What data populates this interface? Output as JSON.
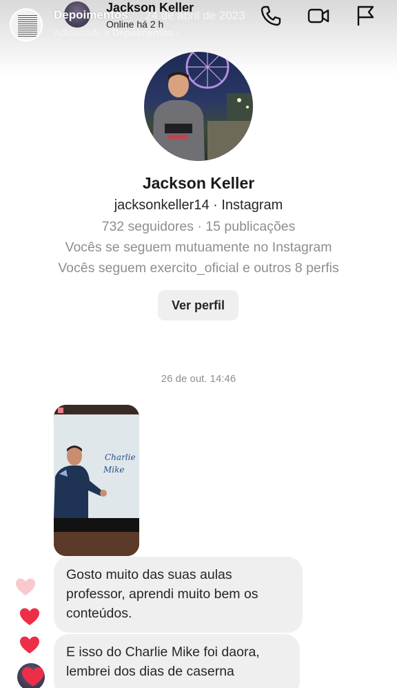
{
  "story": {
    "title": "Depoimentos",
    "date": "24 de abril de 2023",
    "added_prefix": "Adicionado a ",
    "added_target": "Depoimentos",
    "chevron": "chevron-right-icon"
  },
  "chat": {
    "name": "Jackson Keller",
    "status": "Online há 2 h",
    "icons": [
      "phone-icon",
      "video-camera-icon",
      "flag-icon"
    ]
  },
  "profile": {
    "name": "Jackson Keller",
    "handle": "jacksonkeller14 · Instagram",
    "stats": "732 seguidores · 15 publicações",
    "mutual": "Vocês se seguem mutuamente no Instagram",
    "following": "Vocês seguem exercito_oficial e outros 8 perfis",
    "view_button": "Ver perfil"
  },
  "thread": {
    "timestamp": "26 de out. 14:46",
    "media": {
      "board_text_line1": "Charlie",
      "board_text_line2": "Mike"
    },
    "messages": [
      {
        "text": "Gosto muito das suas aulas professor, aprendi muito bem os conteúdos.",
        "reaction": "heart-outline-icon",
        "color": "#f7c9ce"
      },
      {
        "text": "E isso do Charlie Mike foi daora, lembrei dos dias de caserna",
        "reaction": "heart-icon",
        "color": "#ed2e48"
      }
    ]
  },
  "colors": {
    "heart_red": "#ed2e48",
    "heart_light": "#f7c9ce",
    "bubble": "#efefef",
    "muted_text": "#8e8e8e"
  }
}
